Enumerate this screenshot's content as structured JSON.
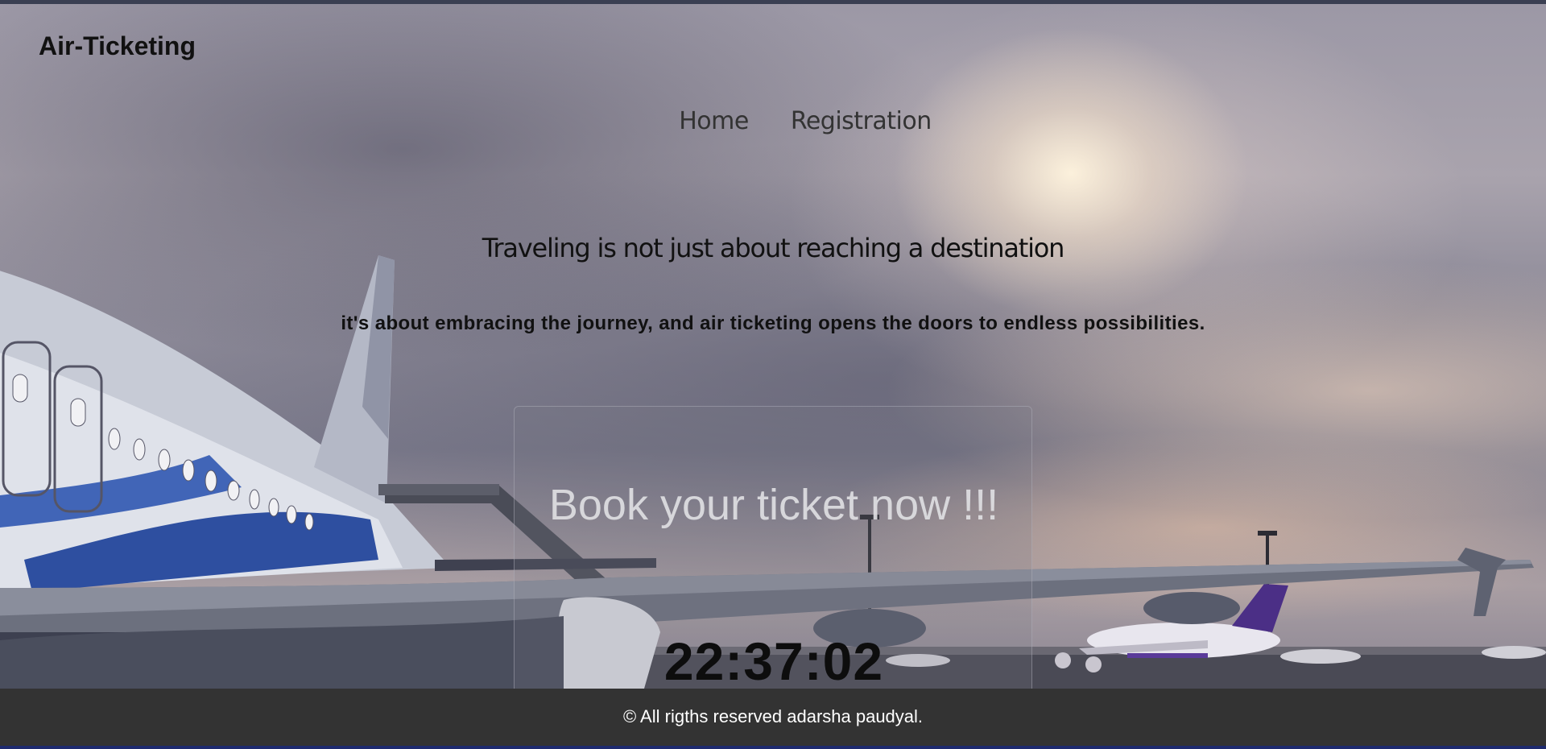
{
  "header": {
    "brand": "Air-Ticketing"
  },
  "nav": {
    "items": [
      {
        "label": "Home"
      },
      {
        "label": "Registration"
      }
    ]
  },
  "hero": {
    "headline": "Traveling is not just about reaching a destination",
    "tagline": "it's about embracing the journey, and air ticketing opens the doors to endless possibilities.",
    "background_image": "airport-airplane-cloudy-sky"
  },
  "booking": {
    "title": "Book your ticket now !!!",
    "clock": "22:37:02"
  },
  "footer": {
    "text": "© All rigths reserved adarsha paudyal."
  },
  "colors": {
    "footer_bg": "#333333",
    "text_dark": "#111111",
    "book_title": "#dededf"
  }
}
